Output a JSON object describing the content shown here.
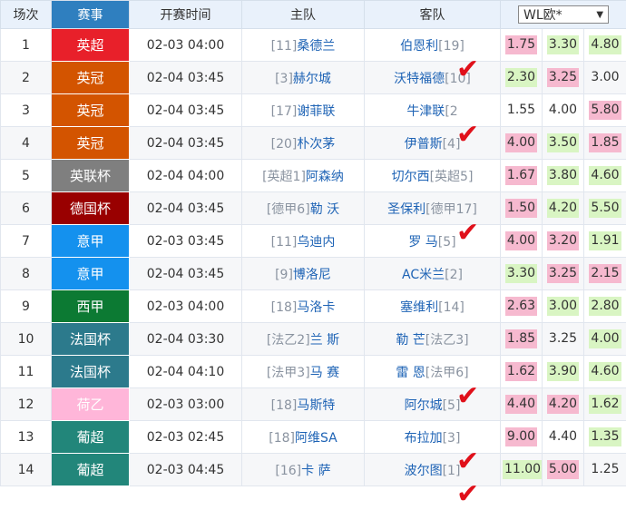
{
  "header": {
    "col_round": "场次",
    "col_league": "赛事",
    "col_time": "开赛时间",
    "col_home": "主队",
    "col_away": "客队",
    "odds_select": "WL欧*",
    "odds_select_arrow": "chevron-down-icon"
  },
  "colors": {
    "england_premier": "#e8202a",
    "england_champ": "#d35400",
    "league_cup": "#7f7f7f",
    "germany_cup": "#990000",
    "italy": "#1491ee",
    "spain": "#0c7a33",
    "france_cup": "#2c7a8c",
    "netherlands": "#ffb6d9",
    "portugal": "#22867a",
    "odds_high": "#f6b9cf",
    "odds_low": "#d9f5c3"
  },
  "check_icon": "check-mark-icon",
  "matches": [
    {
      "no": "1",
      "league": "英超",
      "color": "#e8202a",
      "time": "02-03 04:00",
      "home": {
        "pre": "",
        "rank": "[11]",
        "name": "桑德兰",
        "post": ""
      },
      "away": {
        "pre": "",
        "name": "伯恩利",
        "rank": "[19]",
        "post": ""
      },
      "odds": [
        {
          "v": "1.75",
          "hl": "hi"
        },
        {
          "v": "3.30",
          "hl": "lo"
        },
        {
          "v": "4.80",
          "hl": "lo"
        }
      ],
      "check": true
    },
    {
      "no": "2",
      "league": "英冠",
      "color": "#d35400",
      "time": "02-04 03:45",
      "home": {
        "pre": "",
        "rank": "[3]",
        "name": "赫尔城",
        "post": ""
      },
      "away": {
        "pre": "",
        "name": "沃特福德",
        "rank": "[10]",
        "post": ""
      },
      "odds": [
        {
          "v": "2.30",
          "hl": "lo"
        },
        {
          "v": "3.25",
          "hl": "hi"
        },
        {
          "v": "3.00",
          "hl": ""
        }
      ],
      "check": false
    },
    {
      "no": "3",
      "league": "英冠",
      "color": "#d35400",
      "time": "02-04 03:45",
      "home": {
        "pre": "",
        "rank": "[17]",
        "name": "谢菲联",
        "post": ""
      },
      "away": {
        "pre": "",
        "name": "牛津联",
        "rank": "[2",
        "post": ""
      },
      "odds": [
        {
          "v": "1.55",
          "hl": ""
        },
        {
          "v": "4.00",
          "hl": ""
        },
        {
          "v": "5.80",
          "hl": "hi"
        }
      ],
      "check": true
    },
    {
      "no": "4",
      "league": "英冠",
      "color": "#d35400",
      "time": "02-04 03:45",
      "home": {
        "pre": "",
        "rank": "[20]",
        "name": "朴次茅",
        "post": ""
      },
      "away": {
        "pre": "",
        "name": "伊普斯",
        "rank": "[4]",
        "post": ""
      },
      "odds": [
        {
          "v": "4.00",
          "hl": "hi"
        },
        {
          "v": "3.50",
          "hl": "lo"
        },
        {
          "v": "1.85",
          "hl": "hi"
        }
      ],
      "check": false
    },
    {
      "no": "5",
      "league": "英联杯",
      "color": "#7f7f7f",
      "time": "02-04 04:00",
      "home": {
        "pre": "[英超1]",
        "rank": "",
        "name": "阿森纳",
        "post": ""
      },
      "away": {
        "pre": "",
        "name": "切尔西",
        "rank": "[英超5]",
        "post": ""
      },
      "odds": [
        {
          "v": "1.67",
          "hl": "hi"
        },
        {
          "v": "3.80",
          "hl": "lo"
        },
        {
          "v": "4.60",
          "hl": "lo"
        }
      ],
      "check": false
    },
    {
      "no": "6",
      "league": "德国杯",
      "color": "#990000",
      "time": "02-04 03:45",
      "home": {
        "pre": "[德甲6]",
        "rank": "",
        "name": "勒 沃",
        "post": ""
      },
      "away": {
        "pre": "",
        "name": "圣保利",
        "rank": "[德甲17]",
        "post": ""
      },
      "odds": [
        {
          "v": "1.50",
          "hl": "hi"
        },
        {
          "v": "4.20",
          "hl": "lo"
        },
        {
          "v": "5.50",
          "hl": "lo"
        }
      ],
      "check": true
    },
    {
      "no": "7",
      "league": "意甲",
      "color": "#1491ee",
      "time": "02-03 03:45",
      "home": {
        "pre": "",
        "rank": "[11]",
        "name": "乌迪内",
        "post": ""
      },
      "away": {
        "pre": "",
        "name": "罗 马",
        "rank": "[5]",
        "post": ""
      },
      "odds": [
        {
          "v": "4.00",
          "hl": "hi"
        },
        {
          "v": "3.20",
          "hl": "hi"
        },
        {
          "v": "1.91",
          "hl": "lo"
        }
      ],
      "check": false
    },
    {
      "no": "8",
      "league": "意甲",
      "color": "#1491ee",
      "time": "02-04 03:45",
      "home": {
        "pre": "",
        "rank": "[9]",
        "name": "博洛尼",
        "post": ""
      },
      "away": {
        "pre": "",
        "name": "AC米兰",
        "rank": "[2]",
        "post": ""
      },
      "odds": [
        {
          "v": "3.30",
          "hl": "lo"
        },
        {
          "v": "3.25",
          "hl": "hi"
        },
        {
          "v": "2.15",
          "hl": "hi"
        }
      ],
      "check": false
    },
    {
      "no": "9",
      "league": "西甲",
      "color": "#0c7a33",
      "time": "02-03 04:00",
      "home": {
        "pre": "",
        "rank": "[18]",
        "name": "马洛卡",
        "post": ""
      },
      "away": {
        "pre": "",
        "name": "塞维利",
        "rank": "[14]",
        "post": ""
      },
      "odds": [
        {
          "v": "2.63",
          "hl": "hi"
        },
        {
          "v": "3.00",
          "hl": "lo"
        },
        {
          "v": "2.80",
          "hl": "lo"
        }
      ],
      "check": false
    },
    {
      "no": "10",
      "league": "法国杯",
      "color": "#2c7a8c",
      "time": "02-04 03:30",
      "home": {
        "pre": "[法乙2]",
        "rank": "",
        "name": "兰 斯",
        "post": ""
      },
      "away": {
        "pre": "",
        "name": "勒 芒",
        "rank": "[法乙3]",
        "post": ""
      },
      "odds": [
        {
          "v": "1.85",
          "hl": "hi"
        },
        {
          "v": "3.25",
          "hl": ""
        },
        {
          "v": "4.00",
          "hl": "lo"
        }
      ],
      "check": false
    },
    {
      "no": "11",
      "league": "法国杯",
      "color": "#2c7a8c",
      "time": "02-04 04:10",
      "home": {
        "pre": "[法甲3]",
        "rank": "",
        "name": "马 赛",
        "post": ""
      },
      "away": {
        "pre": "",
        "name": "雷 恩",
        "rank": "[法甲6]",
        "post": ""
      },
      "odds": [
        {
          "v": "1.62",
          "hl": "hi"
        },
        {
          "v": "3.90",
          "hl": "lo"
        },
        {
          "v": "4.60",
          "hl": "lo"
        }
      ],
      "check": true
    },
    {
      "no": "12",
      "league": "荷乙",
      "color": "#ffb6d9",
      "time": "02-03 03:00",
      "home": {
        "pre": "",
        "rank": "[18]",
        "name": "马斯特",
        "post": ""
      },
      "away": {
        "pre": "",
        "name": "阿尔城",
        "rank": "[5]",
        "post": ""
      },
      "odds": [
        {
          "v": "4.40",
          "hl": "hi"
        },
        {
          "v": "4.20",
          "hl": "hi"
        },
        {
          "v": "1.62",
          "hl": "lo"
        }
      ],
      "check": false
    },
    {
      "no": "13",
      "league": "葡超",
      "color": "#22867a",
      "time": "02-03 02:45",
      "home": {
        "pre": "",
        "rank": "[18]",
        "name": "阿维SA",
        "post": ""
      },
      "away": {
        "pre": "",
        "name": "布拉加",
        "rank": "[3]",
        "post": ""
      },
      "odds": [
        {
          "v": "9.00",
          "hl": "hi"
        },
        {
          "v": "4.40",
          "hl": ""
        },
        {
          "v": "1.35",
          "hl": "lo"
        }
      ],
      "check": true
    },
    {
      "no": "14",
      "league": "葡超",
      "color": "#22867a",
      "time": "02-03 04:45",
      "home": {
        "pre": "",
        "rank": "[16]",
        "name": "卡 萨",
        "post": ""
      },
      "away": {
        "pre": "",
        "name": "波尔图",
        "rank": "[1]",
        "post": ""
      },
      "odds": [
        {
          "v": "11.00",
          "hl": "lo"
        },
        {
          "v": "5.00",
          "hl": "hi"
        },
        {
          "v": "1.25",
          "hl": ""
        }
      ],
      "check": true
    }
  ]
}
